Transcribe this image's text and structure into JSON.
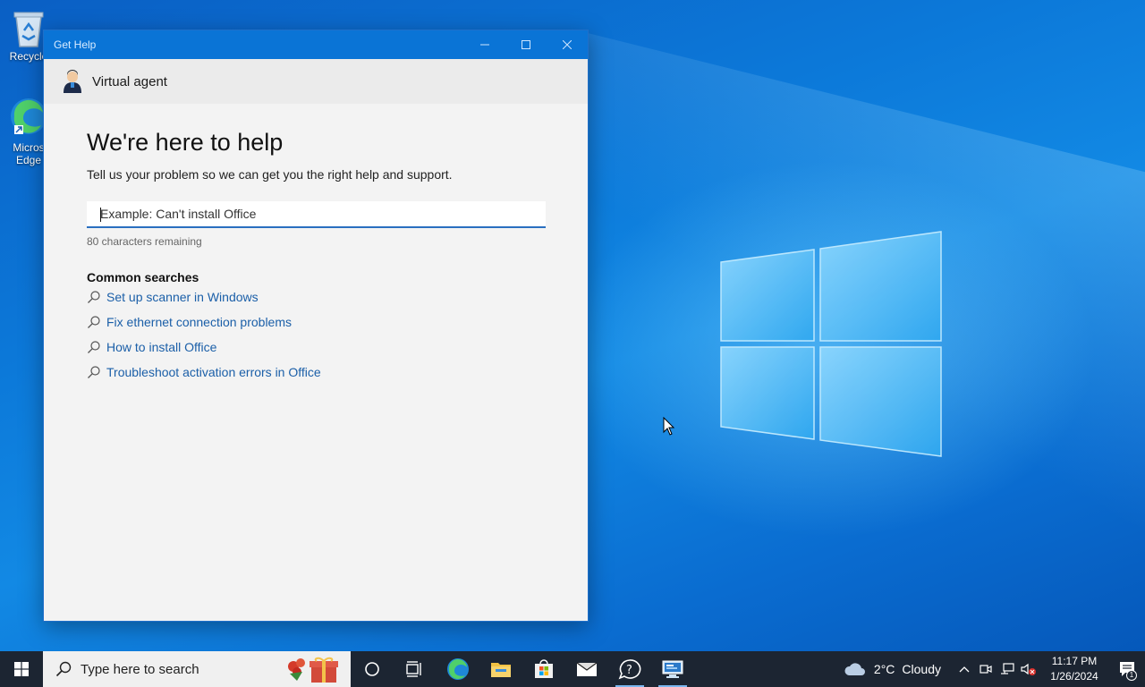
{
  "desktop": {
    "icons": [
      {
        "label": "Recycle",
        "icon": "recycle-bin-icon"
      },
      {
        "label_line1": "Micros",
        "label_line2": "Edge",
        "icon": "edge-icon"
      }
    ]
  },
  "window": {
    "title": "Get Help",
    "agent_label": "Virtual agent",
    "headline": "We're here to help",
    "subline": "Tell us your problem so we can get you the right help and support.",
    "search": {
      "placeholder": "Example: Can't install Office",
      "value": ""
    },
    "remaining": "80 characters remaining",
    "common_title": "Common searches",
    "common_searches": [
      "Set up scanner in Windows",
      "Fix ethernet connection problems",
      "How to install Office",
      "Troubleshoot activation errors in Office"
    ]
  },
  "taskbar": {
    "search_placeholder": "Type here to search",
    "pinned": [
      "cortana-icon",
      "task-view-icon",
      "edge-icon",
      "file-explorer-icon",
      "store-icon",
      "mail-icon",
      "get-help-icon",
      "remote-desktop-icon"
    ],
    "weather": {
      "temp": "2°C",
      "condition": "Cloudy"
    },
    "clock": {
      "time": "11:17 PM",
      "date": "1/26/2024"
    },
    "notifications_count": "1"
  },
  "colors": {
    "titlebar": "#0a74d6",
    "link": "#1b5fa8",
    "taskbar": "#1c2532"
  }
}
